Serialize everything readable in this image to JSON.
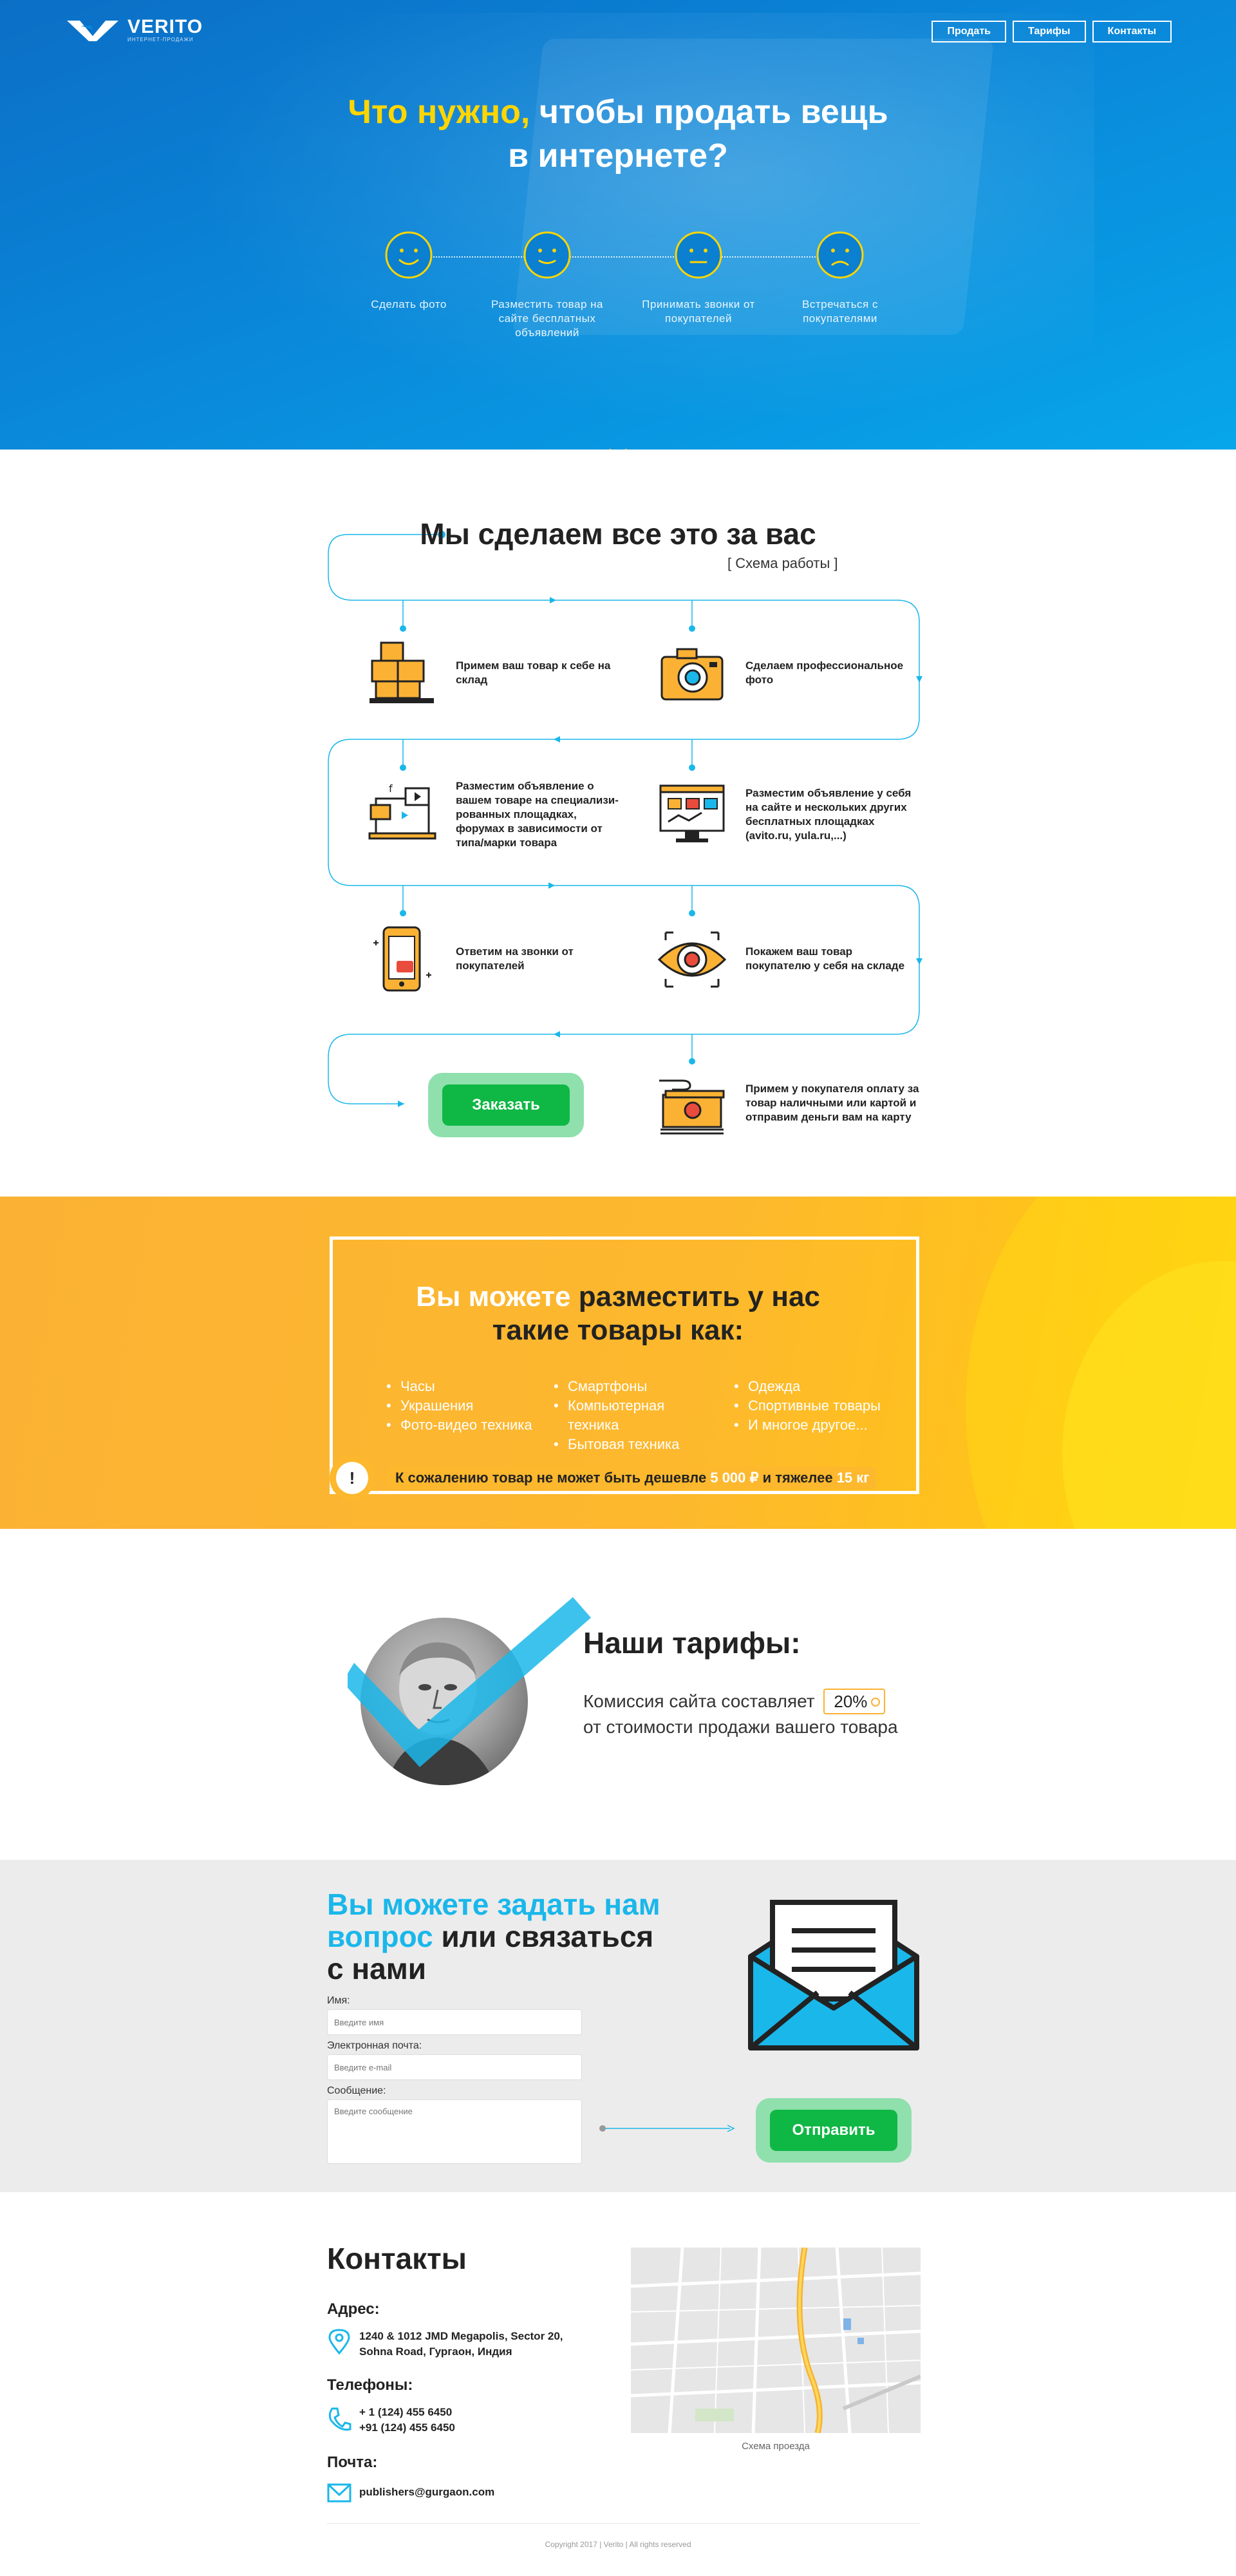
{
  "header": {
    "brand": "VERITO",
    "brand_sub": "ИНТЕРНЕТ-ПРОДАЖИ",
    "nav": [
      "Продать",
      "Тарифы",
      "Контакты"
    ]
  },
  "hero": {
    "title_accent": "Что нужно,",
    "title_rest": " чтобы продать вещь",
    "title_line2": "в интернете?",
    "steps": [
      {
        "icon": "happy-face-icon",
        "label": "Сделать фото"
      },
      {
        "icon": "smile-face-icon",
        "label": "Разместить товар на сайте бесплатных объявлений"
      },
      {
        "icon": "neutral-face-icon",
        "label": "Принимать звонки от покупателей"
      },
      {
        "icon": "sad-face-icon",
        "label": "Встречаться с покупателями"
      }
    ]
  },
  "process": {
    "title": "Мы сделаем все это за вас",
    "subtitle": "[  Схема работы  ]",
    "items": [
      {
        "icon": "warehouse-boxes-icon",
        "text": "Примем ваш товар к себе на склад"
      },
      {
        "icon": "camera-icon",
        "text": "Сделаем профессиональное фото"
      },
      {
        "icon": "laptop-ads-icon",
        "text": "Разместим объявление о вашем товаре на специализи-рованных площадках, форумах в зависимости от типа/марки товара"
      },
      {
        "icon": "monitor-shop-icon",
        "text": "Разместим объявление у себя на сайте и нескольких других бесплатных площадках (avito.ru, yula.ru,...)"
      },
      {
        "icon": "phone-call-icon",
        "text": "Ответим на звонки от покупателей"
      },
      {
        "icon": "eye-icon",
        "text": "Покажем ваш товар покупателю у себя на складе"
      },
      {
        "icon": "money-hand-icon",
        "text": "Примем у покупателя оплату за товар наличными или картой и отправим деньги вам на карту"
      }
    ],
    "order_button": "Заказать"
  },
  "goods": {
    "title_white": "Вы можете",
    "title_dark": " разместить у нас",
    "title_line2": "такие товары как:",
    "col1": [
      "Часы",
      "Украшения",
      "Фото-видео техника"
    ],
    "col2": [
      "Смартфоны",
      "Компьютерная техника",
      "Бытовая техника"
    ],
    "col3": [
      "Одежда",
      "Спортивные товары",
      "И многое другое..."
    ],
    "warn_icon": "!",
    "warn_pre": "К сожалению товар не может быть дешевле ",
    "warn_price": "5 000 ₽",
    "warn_mid": " и тяжелее ",
    "warn_weight": "15 кг"
  },
  "tariffs": {
    "title": "Наши тарифы:",
    "line1_pre": "Комиссия сайта составляет",
    "percent": "20%",
    "line2": "от стоимости продажи вашего товара"
  },
  "ask": {
    "title_blue1": "Вы можете задать нам",
    "title_blue2": "вопрос",
    "title_dark2": " или связаться",
    "title_dark3": "с нами",
    "name_label": "Имя:",
    "name_placeholder": "Введите имя",
    "email_label": "Электронная почта:",
    "email_placeholder": "Введите e-mail",
    "message_label": "Сообщение:",
    "message_placeholder": "Введите сообщение",
    "send_button": "Отправить"
  },
  "contacts": {
    "title": "Контакты",
    "address_label": "Адрес:",
    "address_line1": "1240 & 1012 JMD Megapolis, Sector 20,",
    "address_line2": "Sohna Road, Гургаон, Индия",
    "phones_label": "Телефоны:",
    "phone1": "+ 1 (124) 455 6450",
    "phone2": "+91 (124) 455 6450",
    "mail_label": "Почта:",
    "email": "publishers@gurgaon.com",
    "map_caption": "Схема проезда",
    "copyright": "Copyright 2017   |   Verito   |   All rights reserved"
  },
  "colors": {
    "accent_yellow": "#ffd600",
    "brand_blue": "#1ab7ea",
    "orange": "#fbb234",
    "green": "#0fb744"
  }
}
